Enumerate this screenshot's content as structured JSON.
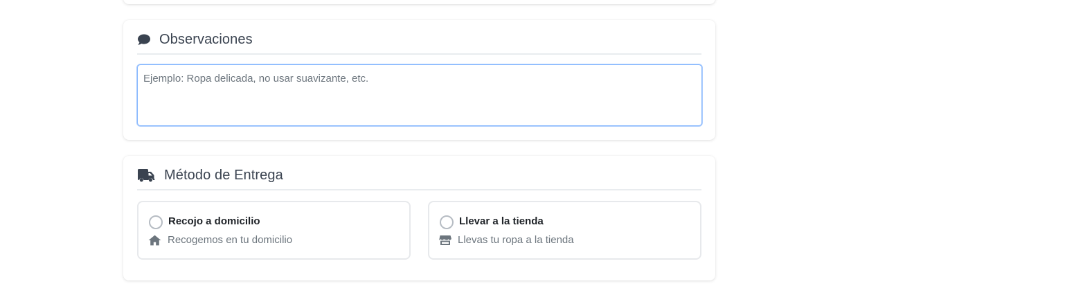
{
  "observaciones": {
    "title": "Observaciones",
    "icon": "comment-icon",
    "placeholder": "Ejemplo: Ropa delicada, no usar suavizante, etc.",
    "value": ""
  },
  "entrega": {
    "title": "Método de Entrega",
    "icon": "truck-icon",
    "options": [
      {
        "label": "Recojo a domicilio",
        "description": "Recogemos en tu domicilio",
        "icon": "home-icon",
        "selected": false
      },
      {
        "label": "Llevar a la tienda",
        "description": "Llevas tu ropa a la tienda",
        "icon": "store-icon",
        "selected": false
      }
    ]
  },
  "colors": {
    "focus_border": "#86b7fe",
    "icon": "#3a4350",
    "muted_text": "#6c757d"
  }
}
